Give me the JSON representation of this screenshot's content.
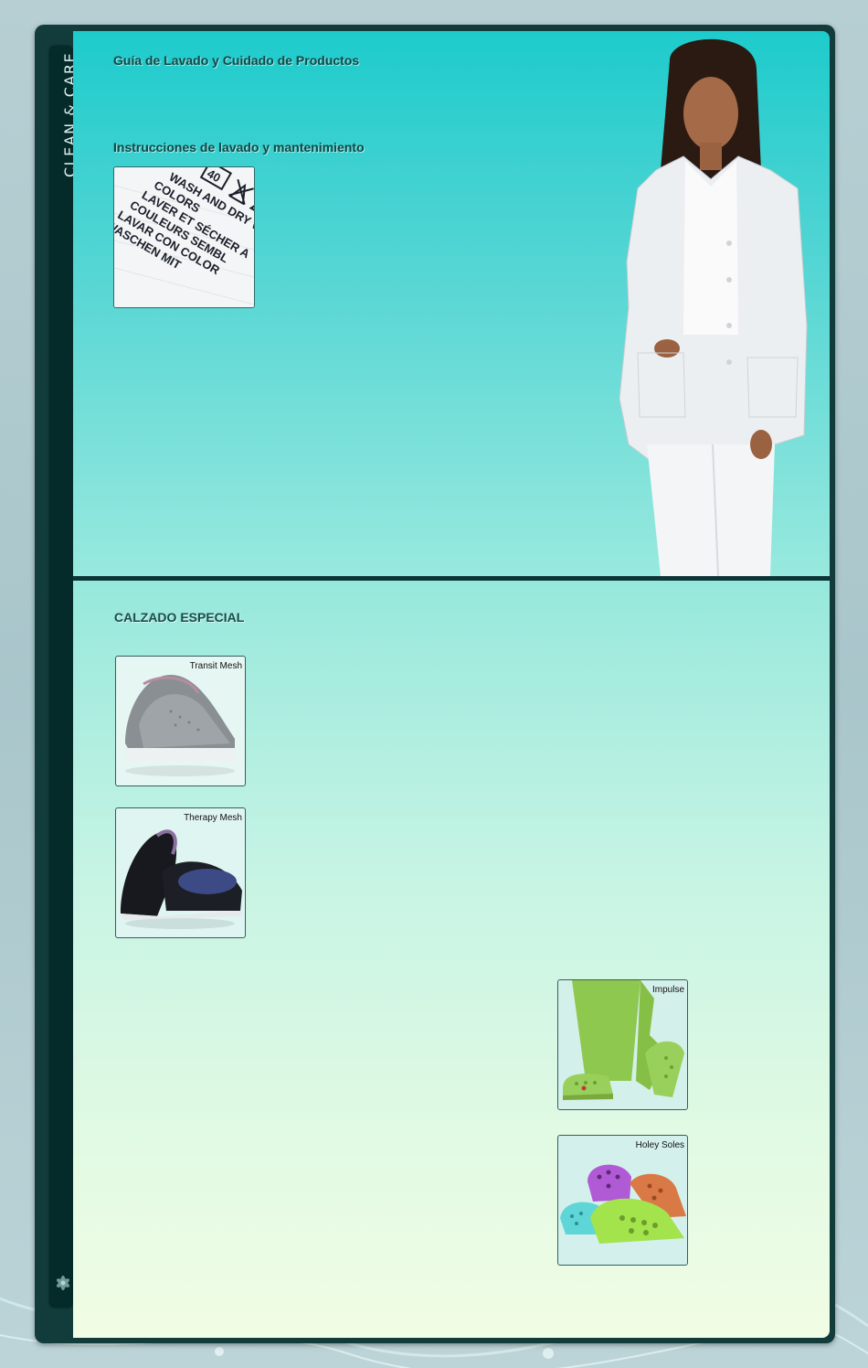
{
  "sidebar": {
    "title": "CLEAN & CARE"
  },
  "care": {
    "title": "Guía de Lavado y Cuidado de Productos",
    "instructions_heading": "Instrucciones de lavado y mantenimiento",
    "label_text": [
      "40",
      "WASH AND DRY WITH",
      "COLORS",
      "LAVER ET SÉCHER A",
      "COULEURS SEMBL",
      "LAVAR CON COLOR",
      "WASCHEN MIT"
    ]
  },
  "footwear": {
    "heading": "CALZADO ESPECIAL",
    "products": [
      {
        "name": "Transit Mesh",
        "icon": "gray-mesh-clog"
      },
      {
        "name": "Therapy Mesh",
        "icon": "black-mesh-clog"
      },
      {
        "name": "Impulse",
        "icon": "green-clog-with-scrub-pants"
      },
      {
        "name": "Holey Soles",
        "icon": "colorful-holey-clogs"
      }
    ]
  },
  "colors": {
    "frame": "#123b3b",
    "sidebar": "#042a2a",
    "heading": "#0d4a48",
    "teal_top": "#1ecbcc",
    "mint_bottom": "#f1fde4"
  }
}
